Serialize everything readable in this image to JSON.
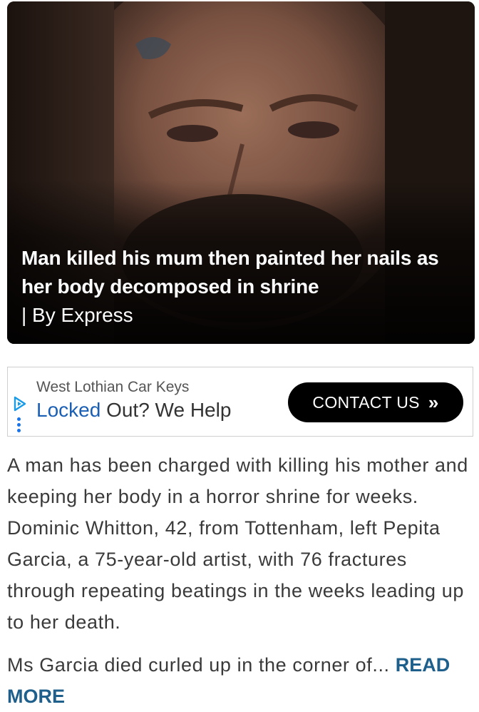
{
  "hero": {
    "title": "Man killed his mum then painted her nails as her body decomposed in shrine",
    "source": "| By Express"
  },
  "ad": {
    "advertiser": "West Lothian Car Keys",
    "headline_keyword": "Locked",
    "headline_rest": " Out? We Help",
    "cta_label": "CONTACT US",
    "cta_icon": "double-chevron-right-icon",
    "choice_icon": "adchoices-icon",
    "menu_icon": "vertical-dots-icon",
    "accent_color": "#1a5fb4"
  },
  "article": {
    "paragraph1": "A man has been charged with killing his mother and keeping her body in a horror shrine for weeks. Dominic Whitton, 42, from Tottenham, left Pepita Garcia, a 75-year-old artist, with 76 fractures through repeating beatings in the weeks leading up to her death.",
    "paragraph2": "Ms Garcia died curled up in the corner of...",
    "read_more": "READ MORE",
    "link_color": "#1f5f8b"
  }
}
